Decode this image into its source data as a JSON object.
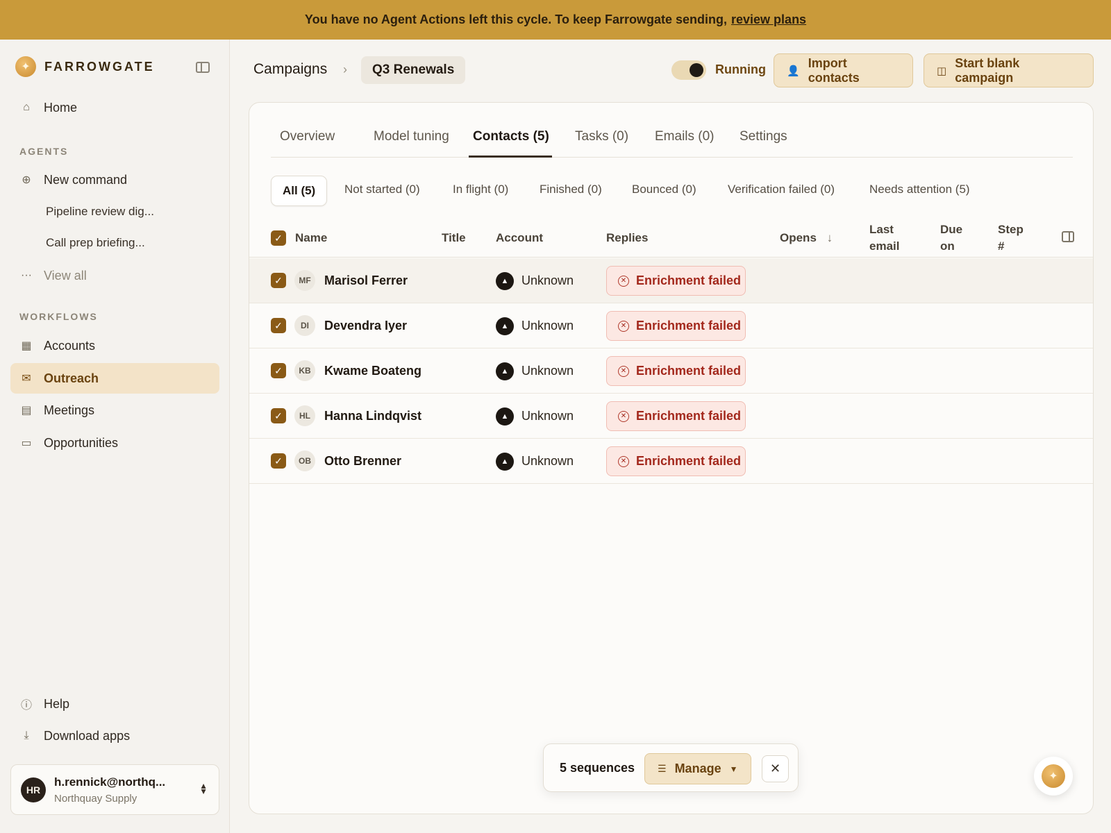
{
  "banner": {
    "text": "You have no Agent Actions left this cycle. To keep Farrowgate sending,",
    "link": "review plans"
  },
  "brand": {
    "name": "FARROWGATE",
    "logo_icon": "sparkle-icon"
  },
  "sidebar": {
    "home": "Home",
    "agents_label": "AGENTS",
    "new_command": "New command",
    "recent": [
      "Pipeline review dig...",
      "Call prep briefing..."
    ],
    "view_all": "View all",
    "workflows_label": "WORKFLOWS",
    "workflows": [
      "Accounts",
      "Outreach",
      "Meetings",
      "Opportunities"
    ],
    "active_workflow": "Outreach",
    "help": "Help",
    "download": "Download apps"
  },
  "user": {
    "initials": "HR",
    "email": "h.rennick@northq...",
    "org": "Northquay Supply"
  },
  "header": {
    "breadcrumb_root": "Campaigns",
    "breadcrumb_current": "Q3 Renewals",
    "status": "Running",
    "status_on": true,
    "import_btn": "Import contacts",
    "blank_btn": "Start blank campaign"
  },
  "tabs": [
    "Overview",
    "Model tuning",
    "Contacts (5)",
    "Tasks (0)",
    "Emails (0)",
    "Settings"
  ],
  "active_tab": "Contacts (5)",
  "filters": [
    "All (5)",
    "Not started (0)",
    "In flight (0)",
    "Finished (0)",
    "Bounced (0)",
    "Verification failed (0)",
    "Needs attention (5)"
  ],
  "active_filter": "All (5)",
  "table": {
    "columns": {
      "name": "Name",
      "title": "Title",
      "account": "Account",
      "replies": "Replies",
      "opens": "Opens",
      "last_email_1": "Last",
      "last_email_2": "email",
      "due_on_1": "Due",
      "due_on_2": "on",
      "step_1": "Step",
      "step_2": "#"
    },
    "rows": [
      {
        "initials": "MF",
        "name": "Marisol Ferrer",
        "account": "Unknown",
        "status": "Enrichment failed"
      },
      {
        "initials": "DI",
        "name": "Devendra Iyer",
        "account": "Unknown",
        "status": "Enrichment failed"
      },
      {
        "initials": "KB",
        "name": "Kwame Boateng",
        "account": "Unknown",
        "status": "Enrichment failed"
      },
      {
        "initials": "HL",
        "name": "Hanna Lindqvist",
        "account": "Unknown",
        "status": "Enrichment failed"
      },
      {
        "initials": "OB",
        "name": "Otto Brenner",
        "account": "Unknown",
        "status": "Enrichment failed"
      }
    ]
  },
  "bulk": {
    "count": "5 sequences",
    "manage": "Manage"
  },
  "colors": {
    "banner": "#c99a3a",
    "accent": "#8a5a16",
    "active_nav_bg": "#f3e3c8",
    "error_bg": "#fce8e3",
    "error_text": "#a3281c"
  }
}
